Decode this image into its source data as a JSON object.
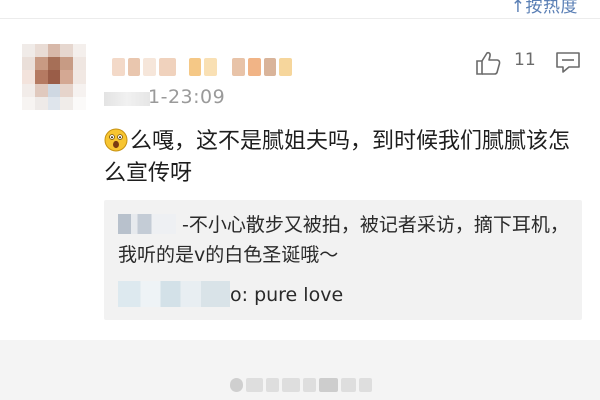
{
  "header": {
    "sort_label": "↑按热度"
  },
  "comment": {
    "like_count": "11",
    "timestamp": "1-23:09",
    "emoji": "surprised-face-emoji",
    "text": "么嘎，这不是腻姐夫吗，到时候我们腻腻该怎么宣传呀"
  },
  "replies": [
    {
      "text": "-不小心散步又被拍，被记者采访，摘下耳机，我听的是v的白色圣诞哦～"
    },
    {
      "text": "o: pure love"
    }
  ],
  "colors": {
    "link_blue": "#5a7fb5",
    "reply_bg": "#f2f2f2",
    "meta_gray": "#9a9a9a"
  }
}
